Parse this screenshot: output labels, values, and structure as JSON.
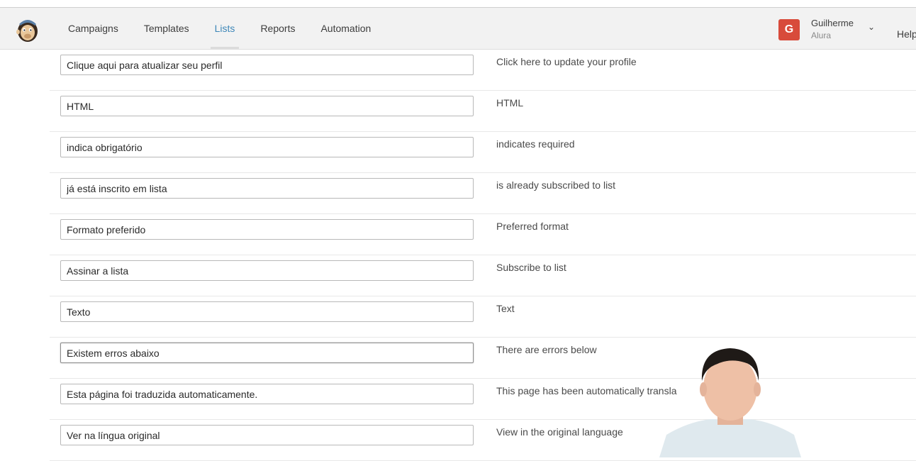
{
  "nav": {
    "items": [
      "Campaigns",
      "Templates",
      "Lists",
      "Reports",
      "Automation"
    ],
    "active": "Lists"
  },
  "user": {
    "initial": "G",
    "name": "Guilherme",
    "org": "Alura",
    "help_label": "Help"
  },
  "rows": [
    {
      "translated": "Clique aqui para atualizar seu perfil",
      "original": "Click here to update your profile"
    },
    {
      "translated": "HTML",
      "original": "HTML"
    },
    {
      "translated": "indica obrigatório",
      "original": "indicates required"
    },
    {
      "translated": "já está inscrito em lista",
      "original": "is already subscribed to list"
    },
    {
      "translated": "Formato preferido",
      "original": "Preferred format"
    },
    {
      "translated": "Assinar a lista",
      "original": "Subscribe to list"
    },
    {
      "translated": "Texto",
      "original": "Text"
    },
    {
      "translated": "Existem erros abaixo",
      "original": "There are errors below"
    },
    {
      "translated": "Esta página foi traduzida automaticamente.",
      "original": "This page has been automatically transla"
    },
    {
      "translated": "Ver na língua original",
      "original": "View in the original language"
    }
  ],
  "colors": {
    "active_nav": "#3e87b8",
    "avatar": "#d84b3b"
  },
  "icons": {
    "logo": "mailchimp-logo",
    "user_menu": "chevron-down-icon"
  }
}
